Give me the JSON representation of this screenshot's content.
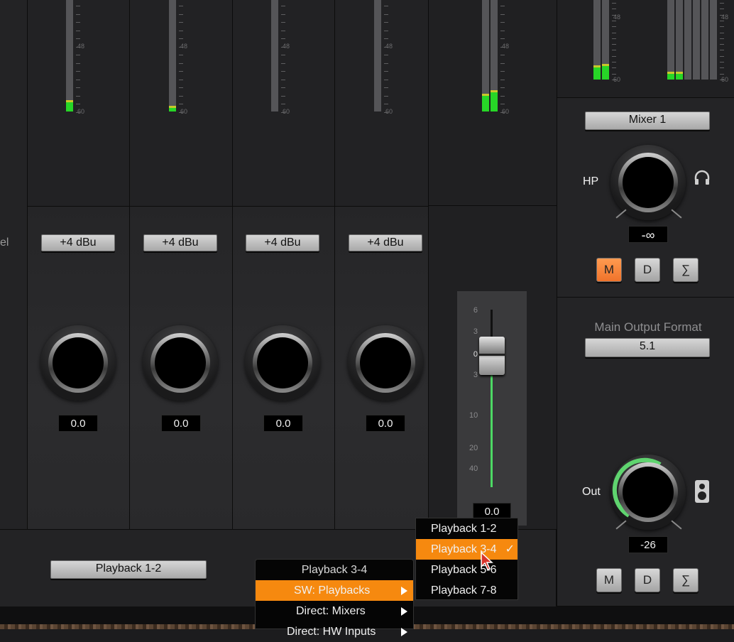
{
  "meters": {
    "scale_48": "48",
    "scale_60": "60",
    "channels": [
      {
        "level": 0.1
      },
      {
        "level": 0.05
      },
      {
        "level": 0.0
      },
      {
        "level": 0.0
      }
    ],
    "master_levels": [
      0.16,
      0.19
    ],
    "phones_levels": [
      0.18,
      0.2
    ],
    "monitor_levels": [
      0.1,
      0.1,
      0.0,
      0.0,
      0.0,
      0.0
    ]
  },
  "channels": [
    {
      "level_button": "+4 dBu",
      "gain_value": "0.0"
    },
    {
      "level_button": "+4 dBu",
      "gain_value": "0.0"
    },
    {
      "level_button": "+4 dBu",
      "gain_value": "0.0"
    },
    {
      "level_button": "+4 dBu",
      "gain_value": "0.0"
    }
  ],
  "left_edge_label": "el",
  "fader": {
    "scale": [
      "6",
      "3",
      "0",
      "3",
      "10",
      "20",
      "40"
    ],
    "value": "0.0"
  },
  "headphones": {
    "mixer_button": "Mixer 1",
    "label": "HP",
    "value": "-∞",
    "buttons": {
      "m": "M",
      "d": "D",
      "sum": "∑"
    },
    "icon": "headphones-icon"
  },
  "main_output": {
    "format_label": "Main Output Format",
    "format_button": "5.1",
    "label": "Out",
    "value": "-26",
    "buttons": {
      "m": "M",
      "d": "D",
      "sum": "∑"
    },
    "icon": "speaker-icon"
  },
  "routing": {
    "output_button": "Playback 1-2"
  },
  "source_menu": {
    "title": "Playback 3-4",
    "items": [
      {
        "label": "SW: Playbacks",
        "selected": true
      },
      {
        "label": "Direct: Mixers",
        "selected": false
      },
      {
        "label": "Direct: HW Inputs",
        "selected": false
      }
    ]
  },
  "submenu": {
    "items": [
      {
        "label": "Playback 1-2",
        "selected": false
      },
      {
        "label": "Playback 3-4",
        "selected": true,
        "check": "✓"
      },
      {
        "label": "Playback 5-6",
        "selected": false
      },
      {
        "label": "Playback 7-8",
        "selected": false
      }
    ]
  },
  "colors": {
    "accent": "#f6890f",
    "meter_green": "#27d627",
    "active_button": "#f57a31",
    "knob_arc": "#4cd964"
  }
}
